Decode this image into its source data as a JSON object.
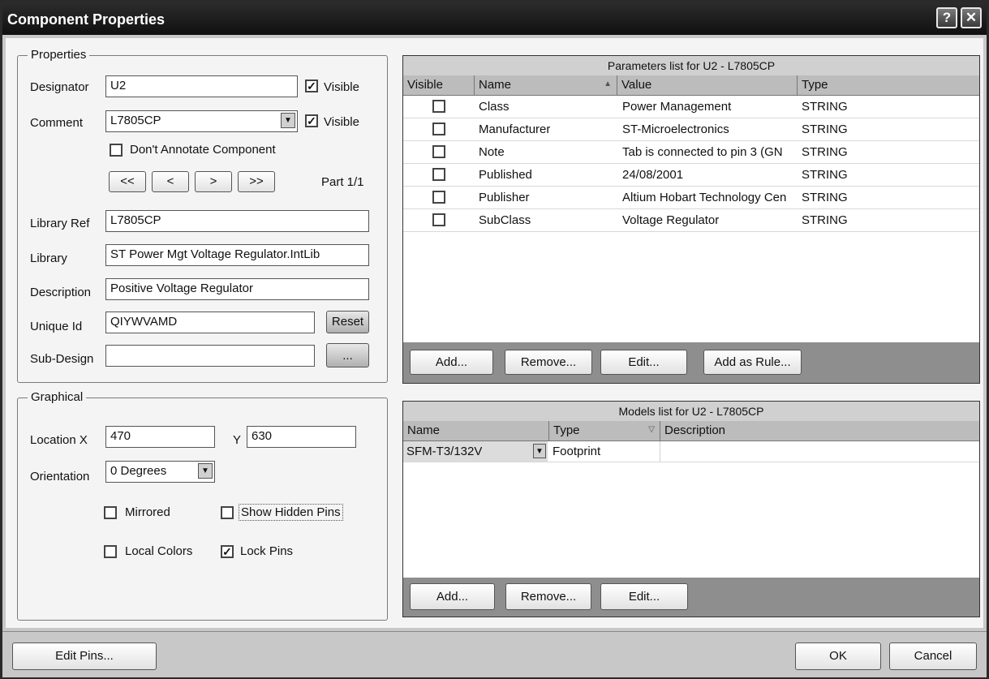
{
  "window": {
    "title": "Component Properties",
    "help_glyph": "?",
    "close_glyph": "✕"
  },
  "properties": {
    "legend": "Properties",
    "designator": {
      "label": "Designator",
      "value": "U2",
      "visible_label": "Visible",
      "visible": true
    },
    "comment": {
      "label": "Comment",
      "value": "L7805CP",
      "visible_label": "Visible",
      "visible": true
    },
    "dont_annotate": {
      "label": "Don't Annotate Component",
      "checked": false
    },
    "nav": {
      "first": "<<",
      "prev": "<",
      "next": ">",
      "last": ">>"
    },
    "part": "Part 1/1",
    "library_ref": {
      "label": "Library Ref",
      "value": "L7805CP"
    },
    "library": {
      "label": "Library",
      "value": "ST Power Mgt Voltage Regulator.IntLib"
    },
    "description": {
      "label": "Description",
      "value": "Positive Voltage Regulator"
    },
    "unique_id": {
      "label": "Unique Id",
      "value": "QIYWVAMD",
      "reset_label": "Reset"
    },
    "sub_design": {
      "label": "Sub-Design",
      "value": "",
      "browse_label": "..."
    }
  },
  "graphical": {
    "legend": "Graphical",
    "location_x": {
      "label": "Location X",
      "value": "470"
    },
    "location_y": {
      "label": "Y",
      "value": "630"
    },
    "orientation": {
      "label": "Orientation",
      "value": "0 Degrees"
    },
    "mirrored": {
      "label": "Mirrored",
      "checked": false
    },
    "show_hidden_pins": {
      "label": "Show Hidden Pins",
      "checked": false
    },
    "local_colors": {
      "label": "Local Colors",
      "checked": false
    },
    "lock_pins": {
      "label": "Lock Pins",
      "checked": true
    }
  },
  "parameters": {
    "title": "Parameters list for U2 - L7805CP",
    "columns": {
      "visible": "Visible",
      "name": "Name",
      "value": "Value",
      "type": "Type"
    },
    "sort_glyph": "▲",
    "rows": [
      {
        "visible": false,
        "name": "Class",
        "value": "Power Management",
        "type": "STRING"
      },
      {
        "visible": false,
        "name": "Manufacturer",
        "value": "ST-Microelectronics",
        "type": "STRING"
      },
      {
        "visible": false,
        "name": "Note",
        "value": "Tab is connected to pin 3 (GN",
        "type": "STRING"
      },
      {
        "visible": false,
        "name": "Published",
        "value": "24/08/2001",
        "type": "STRING"
      },
      {
        "visible": false,
        "name": "Publisher",
        "value": "Altium Hobart Technology Cen",
        "type": "STRING"
      },
      {
        "visible": false,
        "name": "SubClass",
        "value": "Voltage Regulator",
        "type": "STRING"
      }
    ],
    "buttons": {
      "add": "Add...",
      "remove": "Remove...",
      "edit": "Edit...",
      "add_rule": "Add as Rule..."
    }
  },
  "models": {
    "title": "Models list for U2 - L7805CP",
    "columns": {
      "name": "Name",
      "type": "Type",
      "description": "Description"
    },
    "filter_glyph": "▽",
    "rows": [
      {
        "name": "SFM-T3/132V",
        "type": "Footprint",
        "description": ""
      }
    ],
    "buttons": {
      "add": "Add...",
      "remove": "Remove...",
      "edit": "Edit..."
    }
  },
  "footer": {
    "edit_pins": "Edit Pins...",
    "ok": "OK",
    "cancel": "Cancel"
  }
}
